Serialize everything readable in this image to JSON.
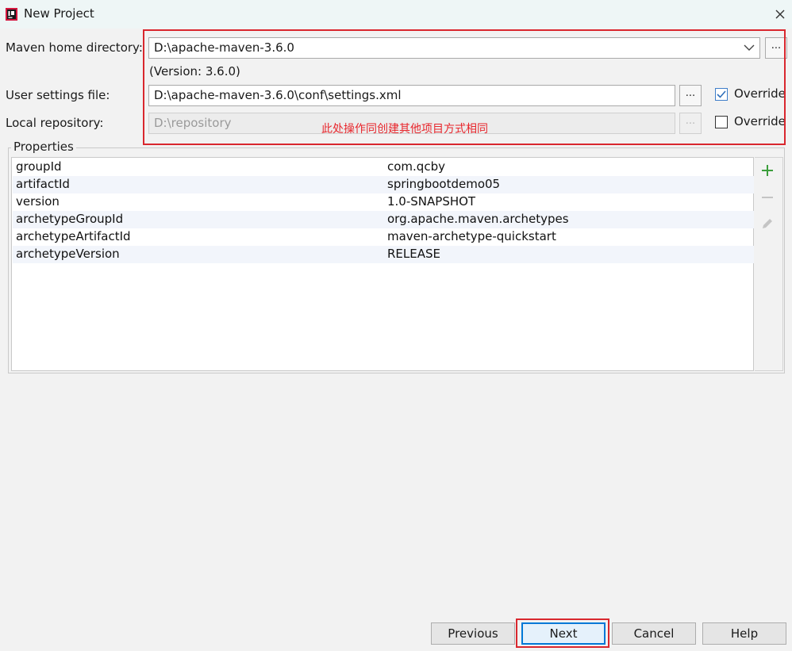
{
  "window": {
    "title": "New Project",
    "app_icon": "intellij-icon",
    "close_icon": "close-icon"
  },
  "maven": {
    "home_label": "Maven home directory:",
    "home_value": "D:\\apache-maven-3.6.0",
    "version_text": "(Version: 3.6.0)",
    "settings_label": "User settings file:",
    "settings_value": "D:\\apache-maven-3.6.0\\conf\\settings.xml",
    "settings_override_label": "Override",
    "settings_override_checked": true,
    "repo_label": "Local repository:",
    "repo_value": "D:\\repository",
    "repo_override_label": "Override",
    "repo_override_checked": false,
    "browse_label": "..."
  },
  "annotation": {
    "text": "此处操作同创建其他项目方式相同",
    "color": "#e8262c"
  },
  "properties": {
    "title": "Properties",
    "rows": [
      {
        "key": "groupId",
        "value": "com.qcby"
      },
      {
        "key": "artifactId",
        "value": "springbootdemo05"
      },
      {
        "key": "version",
        "value": "1.0-SNAPSHOT"
      },
      {
        "key": "archetypeGroupId",
        "value": "org.apache.maven.archetypes"
      },
      {
        "key": "archetypeArtifactId",
        "value": "maven-archetype-quickstart"
      },
      {
        "key": "archetypeVersion",
        "value": "RELEASE"
      }
    ],
    "toolbar": [
      "plus-icon",
      "minus-icon",
      "edit-icon"
    ]
  },
  "buttons": {
    "previous": "Previous",
    "next": "Next",
    "cancel": "Cancel",
    "help": "Help"
  },
  "colors": {
    "highlight_red": "#d9272e",
    "accent_blue": "#0078d7",
    "add_green": "#3c9e3c"
  }
}
